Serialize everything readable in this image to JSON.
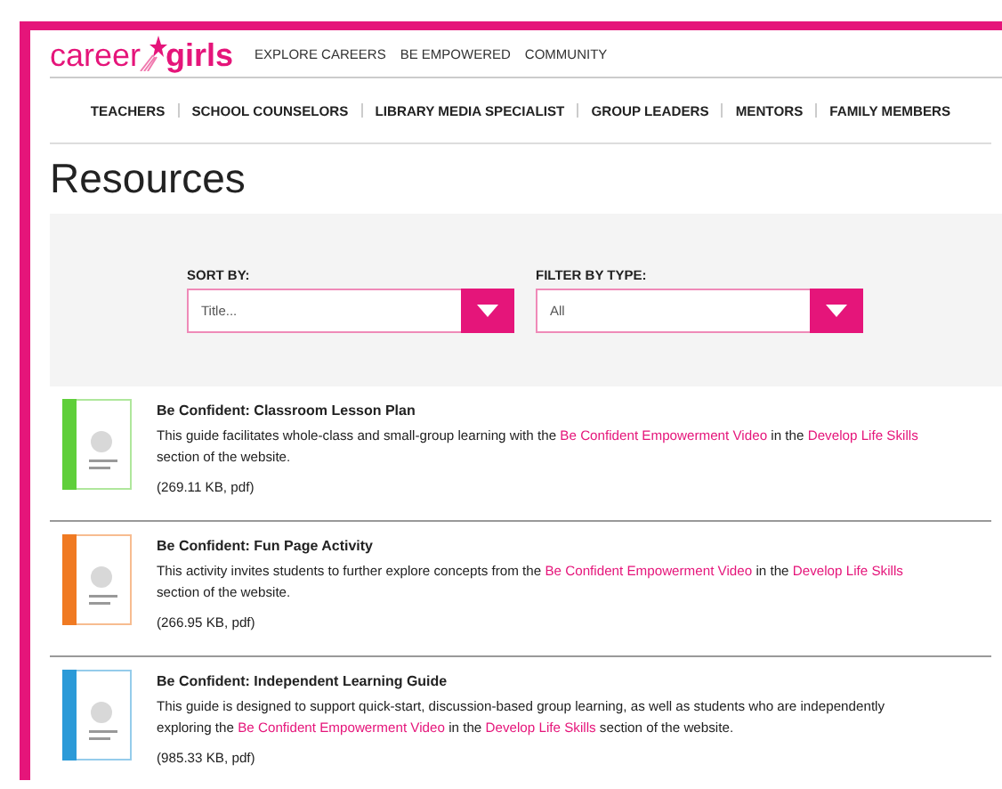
{
  "logo": {
    "first": "career",
    "second": "girls"
  },
  "top_nav": [
    "EXPLORE CAREERS",
    "BE EMPOWERED",
    "COMMUNITY"
  ],
  "audience_nav": [
    "TEACHERS",
    "SCHOOL COUNSELORS",
    "LIBRARY MEDIA SPECIALIST",
    "GROUP LEADERS",
    "MENTORS",
    "FAMILY MEMBERS"
  ],
  "page_title": "Resources",
  "filters": [
    {
      "label": "SORT BY:",
      "value": "Title..."
    },
    {
      "label": "FILTER BY TYPE:",
      "value": "All"
    }
  ],
  "resources": [
    {
      "title": "Be Confident: Classroom Lesson Plan",
      "color": "#5fcf3a",
      "description": [
        {
          "kind": "text",
          "text": "This guide facilitates whole-class and small-group learning with the "
        },
        {
          "kind": "link",
          "text": "Be Confident Empowerment Video"
        },
        {
          "kind": "text",
          "text": " in the "
        },
        {
          "kind": "link",
          "text": "Develop Life Skills"
        },
        {
          "kind": "text",
          "text": " section of the website."
        }
      ],
      "size": "(269.11 KB, pdf)"
    },
    {
      "title": "Be Confident: Fun Page Activity",
      "color": "#f07a22",
      "description": [
        {
          "kind": "text",
          "text": "This activity invites students to further explore concepts from the "
        },
        {
          "kind": "link",
          "text": "Be Confident Empowerment Video"
        },
        {
          "kind": "text",
          "text": " in the "
        },
        {
          "kind": "link",
          "text": "Develop Life Skills"
        },
        {
          "kind": "text",
          "text": " section of the website."
        }
      ],
      "size": "(266.95 KB, pdf)"
    },
    {
      "title": "Be Confident: Independent Learning Guide",
      "color": "#2b9ad8",
      "description": [
        {
          "kind": "text",
          "text": "This guide is designed to support quick-start, discussion-based group learning, as well as students who are independently exploring the "
        },
        {
          "kind": "link",
          "text": "Be Confident Empowerment Video"
        },
        {
          "kind": "text",
          "text": " in the "
        },
        {
          "kind": "link",
          "text": "Develop Life Skills"
        },
        {
          "kind": "text",
          "text": " section of the website."
        }
      ],
      "size": "(985.33 KB, pdf)"
    }
  ]
}
